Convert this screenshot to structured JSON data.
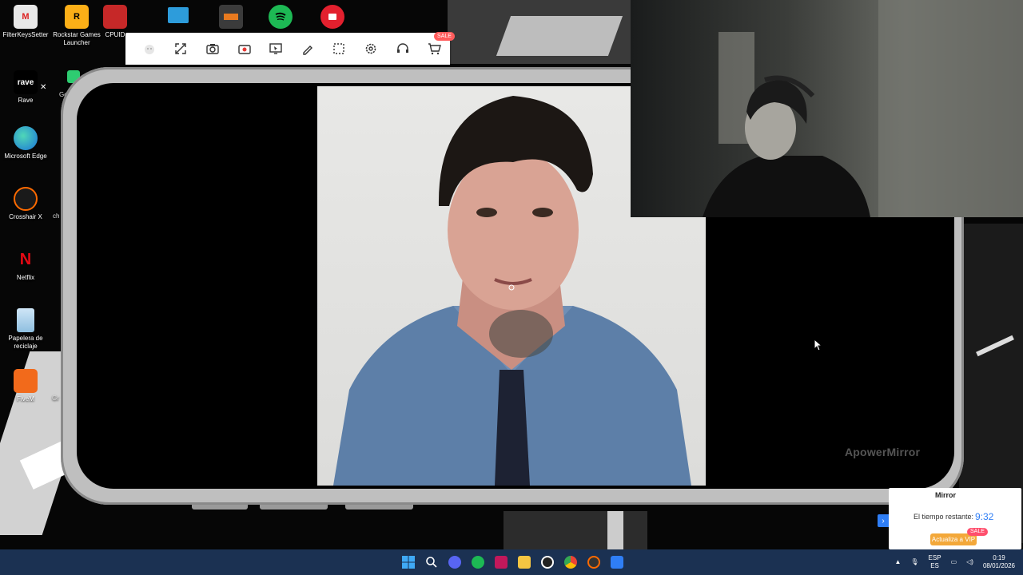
{
  "desktop_icons": [
    {
      "label": "FilterKeysSetter",
      "badge": "M"
    },
    {
      "label": "Rockstar Games\nLauncher",
      "badge": "R"
    },
    {
      "label": "CPUID",
      "badge": ""
    },
    {
      "label": "Rave",
      "badge": "rave"
    },
    {
      "label": "Microsoft Edge",
      "badge": ""
    },
    {
      "label": "Crosshair X",
      "badge": ""
    },
    {
      "label": "Netflix",
      "badge": "N"
    },
    {
      "label": "Papelera de\nreciclaje",
      "badge": ""
    },
    {
      "label": "FiveM",
      "badge": ""
    }
  ],
  "partial_labels": {
    "go": "Go",
    "ch": "ch",
    "gr": "Gr"
  },
  "toolbar": {
    "sale_tag": "SALE",
    "buttons": [
      "logo",
      "fullscreen",
      "screenshot",
      "record",
      "whiteboard",
      "brush",
      "crop",
      "settings",
      "support",
      "store"
    ]
  },
  "watermark": "ApowerMirror",
  "vip": {
    "title": "Mirror",
    "time_label": "El tiempo restante:",
    "time_value": "9:32",
    "upgrade": "Actualiza a VIP",
    "sale": "SALE"
  },
  "tray": {
    "lang_top": "ESP",
    "lang_bottom": "ES",
    "time": "0:19",
    "date": "08/01/2026"
  },
  "colors": {
    "taskbar": "#1b3152",
    "accent_blue": "#2f7ef5",
    "vip_orange": "#f3a83a",
    "sale_red": "#ff4f6d",
    "phone_frame": "#bfbfbf"
  }
}
